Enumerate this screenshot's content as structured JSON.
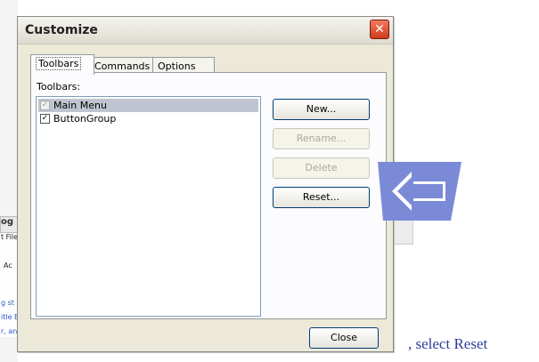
{
  "dialog": {
    "title": "Customize",
    "close_icon": "close-icon",
    "tabs": [
      {
        "label": "Toolbars",
        "active": true
      },
      {
        "label": "Commands",
        "active": false
      },
      {
        "label": "Options",
        "active": false
      }
    ],
    "toolbars_label": "Toolbars:",
    "list_items": [
      {
        "label": "Main Menu",
        "checked": true,
        "selected": true,
        "disabled_check": true
      },
      {
        "label": "ButtonGroup",
        "checked": true,
        "selected": false,
        "disabled_check": false
      }
    ],
    "buttons": {
      "new": "New...",
      "rename": "Rename...",
      "delete": "Delete",
      "reset": "Reset..."
    },
    "close_label": "Close"
  },
  "background": {
    "tab_label": "og",
    "fragments": [
      "t File",
      "Ac",
      "g st",
      "itle E",
      "r, an"
    ]
  },
  "annotation": {
    "arrow_icon": "left-arrow-icon",
    "arrow_color": "#7a8ad6",
    "caption": ", select Reset"
  }
}
